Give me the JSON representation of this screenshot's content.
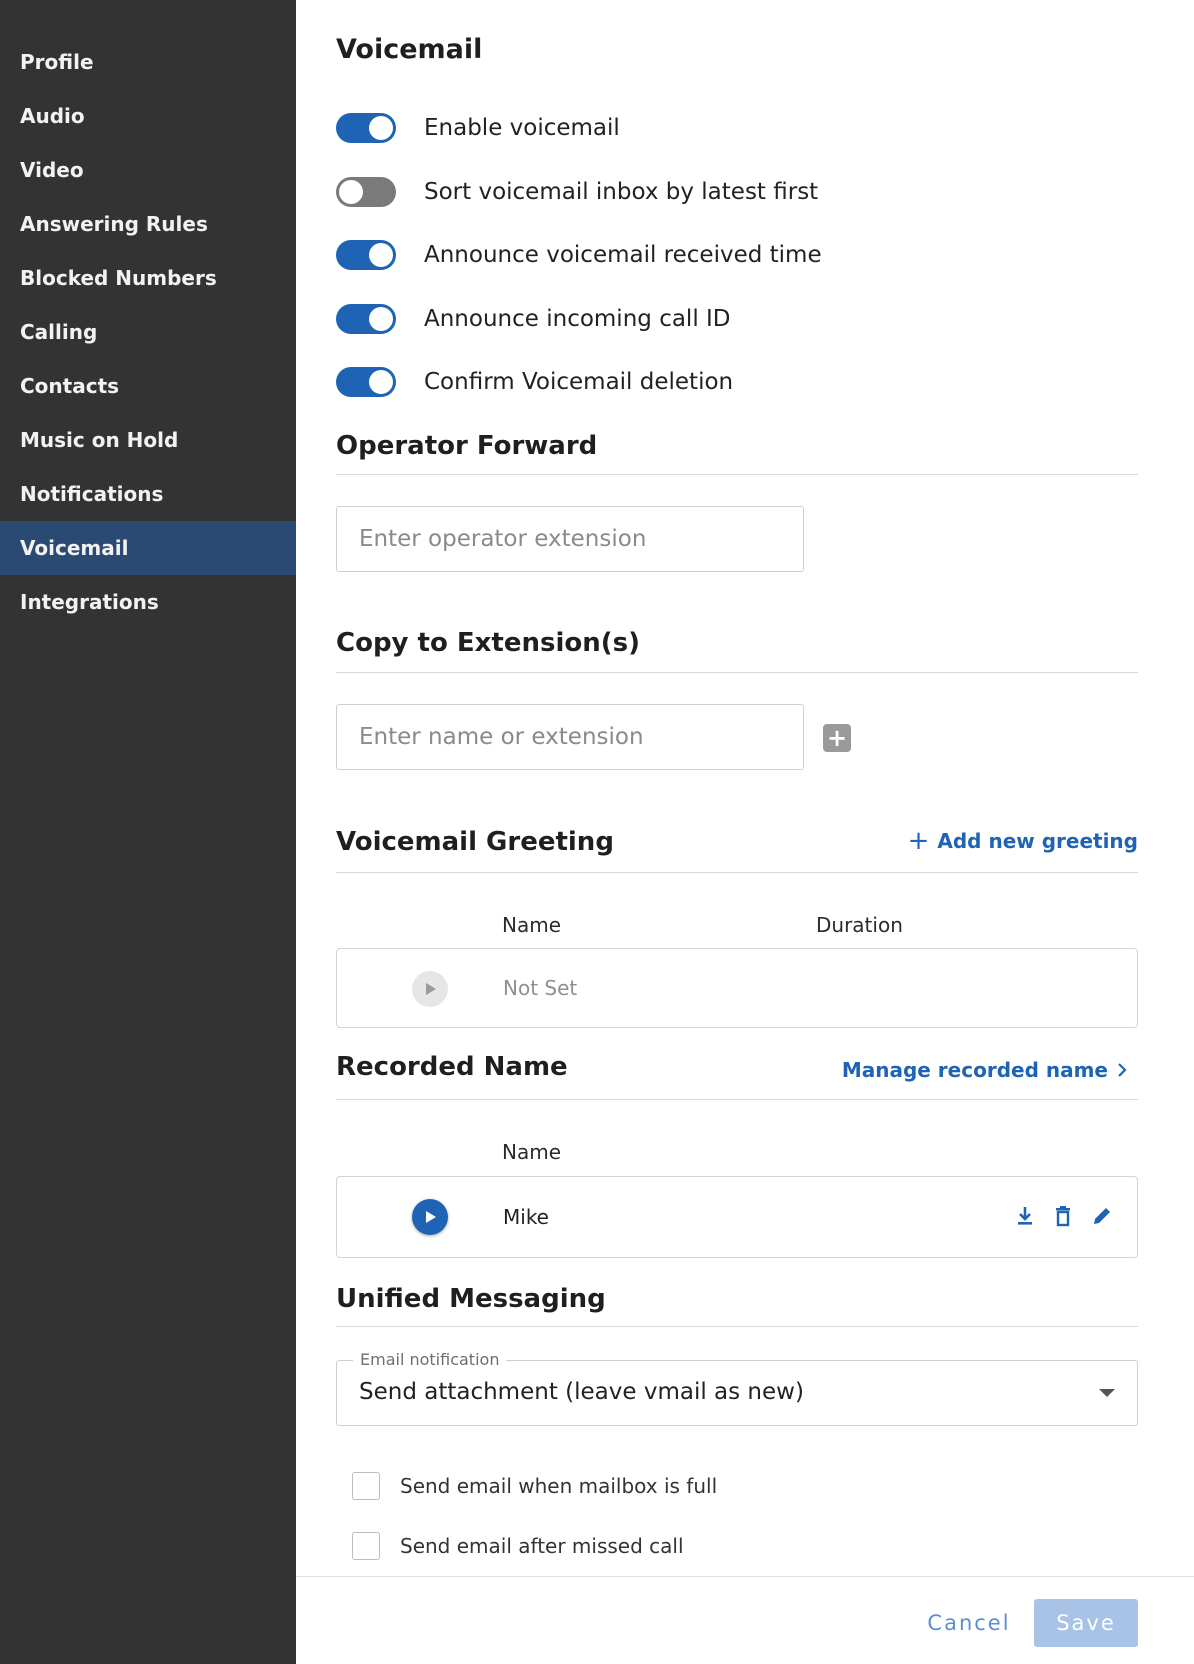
{
  "sidebar": {
    "items": [
      {
        "label": "Profile"
      },
      {
        "label": "Audio"
      },
      {
        "label": "Video"
      },
      {
        "label": "Answering Rules"
      },
      {
        "label": "Blocked Numbers"
      },
      {
        "label": "Calling"
      },
      {
        "label": "Contacts"
      },
      {
        "label": "Music on Hold"
      },
      {
        "label": "Notifications"
      },
      {
        "label": "Voicemail",
        "active": true
      },
      {
        "label": "Integrations"
      }
    ]
  },
  "page": {
    "title": "Voicemail"
  },
  "toggles": [
    {
      "label": "Enable voicemail",
      "on": true
    },
    {
      "label": "Sort voicemail inbox by latest first",
      "on": false
    },
    {
      "label": "Announce voicemail received time",
      "on": true
    },
    {
      "label": "Announce incoming call ID",
      "on": true
    },
    {
      "label": "Confirm Voicemail deletion",
      "on": true
    }
  ],
  "operator_forward": {
    "title": "Operator Forward",
    "placeholder": "Enter operator extension",
    "value": ""
  },
  "copy_to_extension": {
    "title": "Copy to Extension(s)",
    "placeholder": "Enter name or extension",
    "value": "",
    "add_icon": "plus-square-icon"
  },
  "greeting": {
    "title": "Voicemail Greeting",
    "add_label": "Add new greeting",
    "columns": [
      "Name",
      "Duration"
    ],
    "row": {
      "name": "Not Set",
      "duration": ""
    }
  },
  "recorded_name": {
    "title": "Recorded Name",
    "manage_label": "Manage recorded name",
    "columns": [
      "Name"
    ],
    "row": {
      "name": "Mike"
    },
    "actions": [
      "download-icon",
      "trash-icon",
      "pencil-icon"
    ]
  },
  "unified_messaging": {
    "title": "Unified Messaging",
    "select_label": "Email notification",
    "select_value": "Send attachment (leave vmail as new)",
    "checkboxes": [
      {
        "label": "Send email when mailbox is full",
        "checked": false
      },
      {
        "label": "Send email after missed call",
        "checked": false
      }
    ]
  },
  "footer": {
    "cancel_label": "Cancel",
    "save_label": "Save"
  },
  "colors": {
    "accent": "#1f63b5",
    "sidebar_bg": "#333333",
    "sidebar_active": "#2a4a74"
  }
}
